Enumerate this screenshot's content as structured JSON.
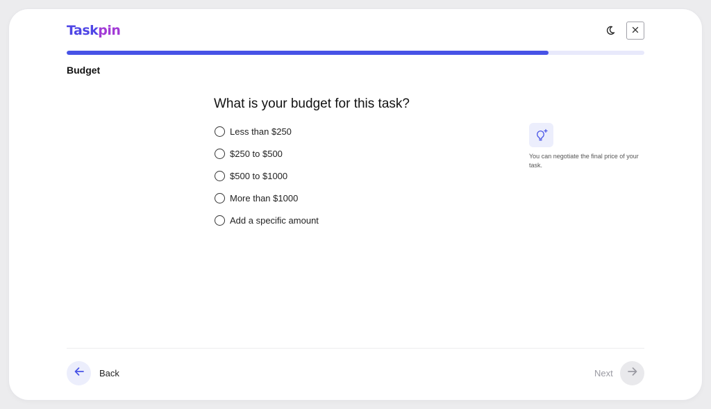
{
  "header": {
    "logo_part1": "Task",
    "logo_part2": "pin",
    "theme_toggle_icon": "moon-icon",
    "close_icon": "close-icon"
  },
  "progress": {
    "percent": 83.4
  },
  "step": {
    "title": "Budget"
  },
  "question": {
    "text": "What is your budget for this task?",
    "options": [
      {
        "label": "Less than $250",
        "selected": false
      },
      {
        "label": "$250 to $500",
        "selected": false
      },
      {
        "label": "$500 to $1000",
        "selected": false
      },
      {
        "label": "More than $1000",
        "selected": false
      },
      {
        "label": "Add a specific amount",
        "selected": false
      }
    ]
  },
  "tip": {
    "icon": "lightbulb-sparkle-icon",
    "text": "You can negotiate the final price of your task."
  },
  "footer": {
    "back_label": "Back",
    "next_label": "Next",
    "back_icon": "arrow-left-icon",
    "next_icon": "arrow-right-icon"
  },
  "colors": {
    "brand_primary": "#4f46e5",
    "brand_secondary": "#a23bd6",
    "progress_fill": "#4753e6",
    "progress_track": "#e8e9fb",
    "accent_soft": "#eceefc"
  }
}
